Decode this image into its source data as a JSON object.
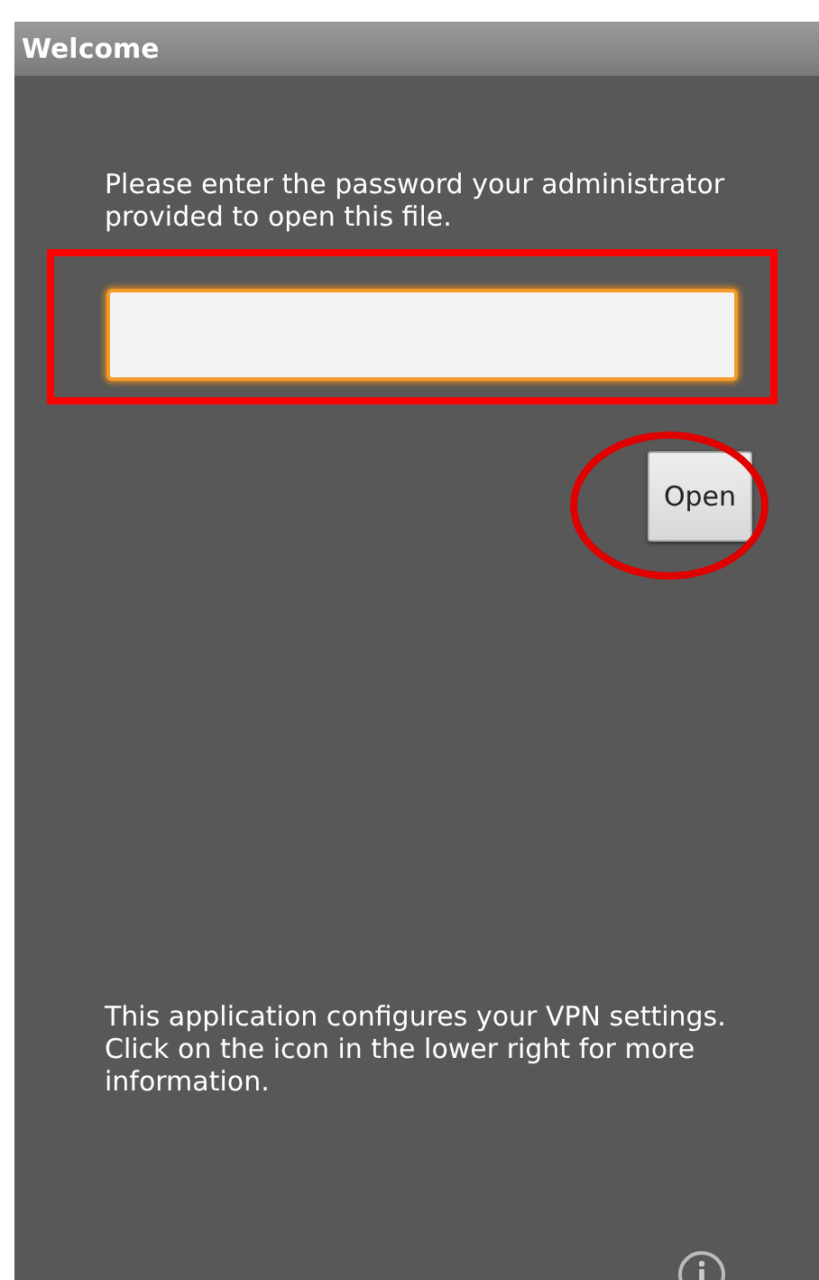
{
  "window": {
    "title": "Welcome"
  },
  "prompt": "Please enter the password your administrator provided to open this file.",
  "password_field": {
    "focused": true
  },
  "open_button": {
    "label": "Open"
  },
  "info_text": "This application configures your VPN settings. Click on the icon in the lower right for more information."
}
